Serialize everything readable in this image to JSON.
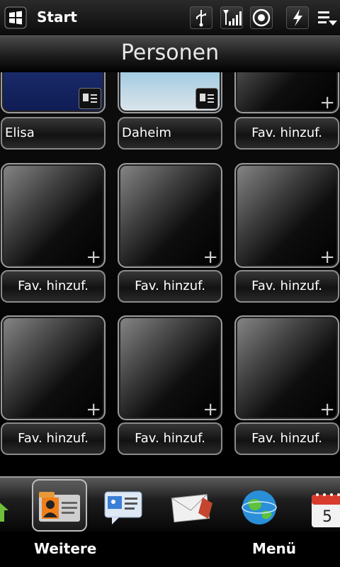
{
  "status_bar": {
    "start_label": "Start",
    "icons": [
      "windows-logo-icon",
      "usb-icon",
      "signal-icon",
      "sync-icon",
      "battery-charging-icon",
      "menu-dropdown-icon"
    ]
  },
  "header": {
    "title": "Personen"
  },
  "favorites": [
    {
      "label": "Elisa",
      "type": "contact",
      "has_photo": true
    },
    {
      "label": "Daheim",
      "type": "contact",
      "has_photo": true
    },
    {
      "label": "Fav. hinzuf.",
      "type": "empty"
    },
    {
      "label": "Fav. hinzuf.",
      "type": "empty"
    },
    {
      "label": "Fav. hinzuf.",
      "type": "empty"
    },
    {
      "label": "Fav. hinzuf.",
      "type": "empty"
    },
    {
      "label": "Fav. hinzuf.",
      "type": "empty"
    },
    {
      "label": "Fav. hinzuf.",
      "type": "empty"
    },
    {
      "label": "Fav. hinzuf.",
      "type": "empty"
    }
  ],
  "dock": {
    "items": [
      {
        "name": "home-icon",
        "selected": false
      },
      {
        "name": "contacts-icon",
        "selected": true
      },
      {
        "name": "messaging-icon",
        "selected": false
      },
      {
        "name": "mail-icon",
        "selected": false
      },
      {
        "name": "internet-globe-icon",
        "selected": false
      },
      {
        "name": "calendar-icon",
        "selected": false,
        "day": "5"
      }
    ]
  },
  "softkeys": {
    "left": "Weitere",
    "right": "Menü"
  },
  "colors": {
    "background": "#000000",
    "text": "#ffffff"
  }
}
